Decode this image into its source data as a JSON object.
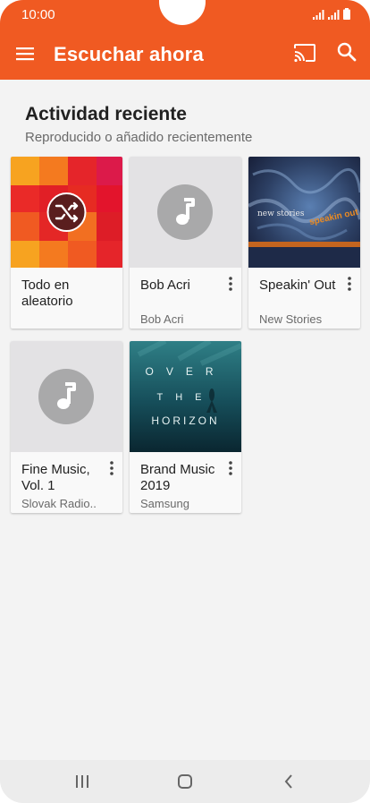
{
  "status_bar": {
    "time": "10:00"
  },
  "app_bar": {
    "title": "Escuchar ahora",
    "color": "#f05a22"
  },
  "section": {
    "title": "Actividad reciente",
    "subtitle": "Reproducido o añadido recientemente"
  },
  "cards": [
    {
      "title": "Todo en aleatorio",
      "subtitle": "",
      "art": "shuffle-mosaic",
      "has_menu": false
    },
    {
      "title": "Bob Acri",
      "subtitle": "Bob Acri",
      "art": "music-note-placeholder",
      "has_menu": true
    },
    {
      "title": "Speakin' Out",
      "subtitle": "New Stories",
      "art": "album-cover-new-stories",
      "has_menu": true
    },
    {
      "title": "Fine Music, Vol. 1",
      "subtitle": "Slovak Radio..",
      "art": "music-note-placeholder",
      "has_menu": true
    },
    {
      "title": "Brand Music 2019",
      "subtitle": "Samsung",
      "art": "album-cover-over-the-horizon",
      "has_menu": true
    }
  ],
  "album_art_text": {
    "new_stories": "new stories",
    "speakin_out": "speakin out",
    "horizon_line1": "OVER",
    "horizon_line2": "THE",
    "horizon_line3": "HORIZON"
  },
  "icons": {
    "menu": "hamburger-icon",
    "cast": "cast-icon",
    "search": "search-icon",
    "more": "more-vert-icon",
    "shuffle": "shuffle-icon",
    "note": "music-note-icon",
    "nav_recents": "recents-icon",
    "nav_home": "home-icon",
    "nav_back": "back-icon"
  }
}
